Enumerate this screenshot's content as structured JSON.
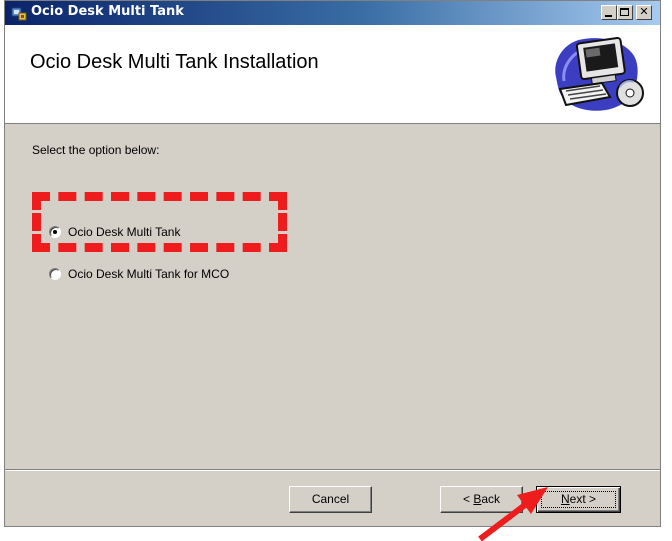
{
  "window": {
    "title": "Ocio Desk Multi Tank"
  },
  "banner": {
    "title": "Ocio Desk Multi Tank Installation",
    "art_icon": "computer-with-disc-icon"
  },
  "content": {
    "instruction": "Select the option below:",
    "options": [
      {
        "label": "Ocio Desk Multi Tank",
        "selected": true
      },
      {
        "label": "Ocio Desk Multi Tank for MCO",
        "selected": false
      }
    ]
  },
  "buttons": {
    "cancel": "Cancel",
    "back_prefix": "< ",
    "back_mnemonic": "B",
    "back_rest": "ack",
    "next_mnemonic": "N",
    "next_rest": "ext >"
  },
  "annotations": {
    "highlight_color": "#ee1c1c",
    "arrow_color": "#ee1c1c"
  },
  "colors": {
    "titlebar_start": "#0a246a",
    "titlebar_end": "#a6caf0",
    "dialog_face": "#d4d0c8"
  }
}
